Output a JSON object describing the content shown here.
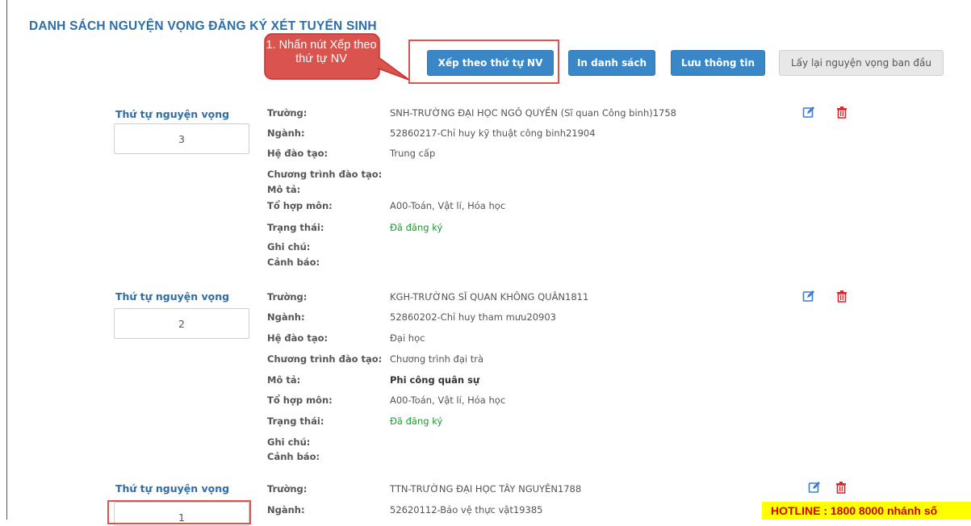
{
  "page_title": "DANH SÁCH NGUYỆN VỌNG ĐĂNG KÝ XÉT TUYỂN SINH",
  "callout": "1. Nhấn nút Xếp theo thứ tự NV",
  "toolbar": {
    "sort_label": "Xếp theo thứ tự NV",
    "print_label": "In danh sách",
    "save_label": "Lưu thông tin",
    "reset_label": "Lấy lại nguyện vọng ban đầu"
  },
  "labels": {
    "rank": "Thứ tự nguyện vọng",
    "school": "Trường:",
    "major": "Ngành:",
    "level": "Hệ đào tạo:",
    "program": "Chương trình đào tạo:",
    "description": "Mô tả:",
    "subjects": "Tổ hợp môn:",
    "status": "Trạng thái:",
    "note": "Ghi chú:",
    "warning": "Cảnh báo:"
  },
  "wishes": [
    {
      "rank": "3",
      "school": "SNH-TRƯỜNG ĐẠI HỌC NGÔ QUYỀN (Sĩ quan Công binh)1758",
      "major": "52860217-Chỉ huy kỹ thuật công binh21904",
      "level": "Trung cấp",
      "program": "",
      "description": "",
      "subjects": "A00-Toán, Vật lí, Hóa học",
      "status": "Đã đăng ký",
      "note": "",
      "warning": ""
    },
    {
      "rank": "2",
      "school": "KGH-TRƯỜNG SĨ QUAN KHÔNG QUÂN1811",
      "major": "52860202-Chỉ huy tham mưu20903",
      "level": "Đại học",
      "program": "Chương trình đại trà",
      "description": "Phi công quân sự",
      "subjects": "A00-Toán, Vật lí, Hóa học",
      "status": "Đã đăng ký",
      "note": "",
      "warning": ""
    },
    {
      "rank": "1",
      "school": "TTN-TRƯỜNG ĐẠI HỌC TÂY NGUYÊN1788",
      "major": "52620112-Bảo vệ thực vật19385"
    }
  ],
  "hotline": "HOTLINE : 1800 8000 nhánh số",
  "colors": {
    "title": "#2d6ea8",
    "primary_button": "#3a87c8",
    "status_green": "#1a9a2c",
    "delete_red": "#d9262a",
    "hotline_bg": "#ffff00",
    "hotline_text": "#d10000",
    "callout_bg": "#d9534f"
  },
  "icons": {
    "edit": "edit-icon",
    "delete": "trash-icon"
  }
}
